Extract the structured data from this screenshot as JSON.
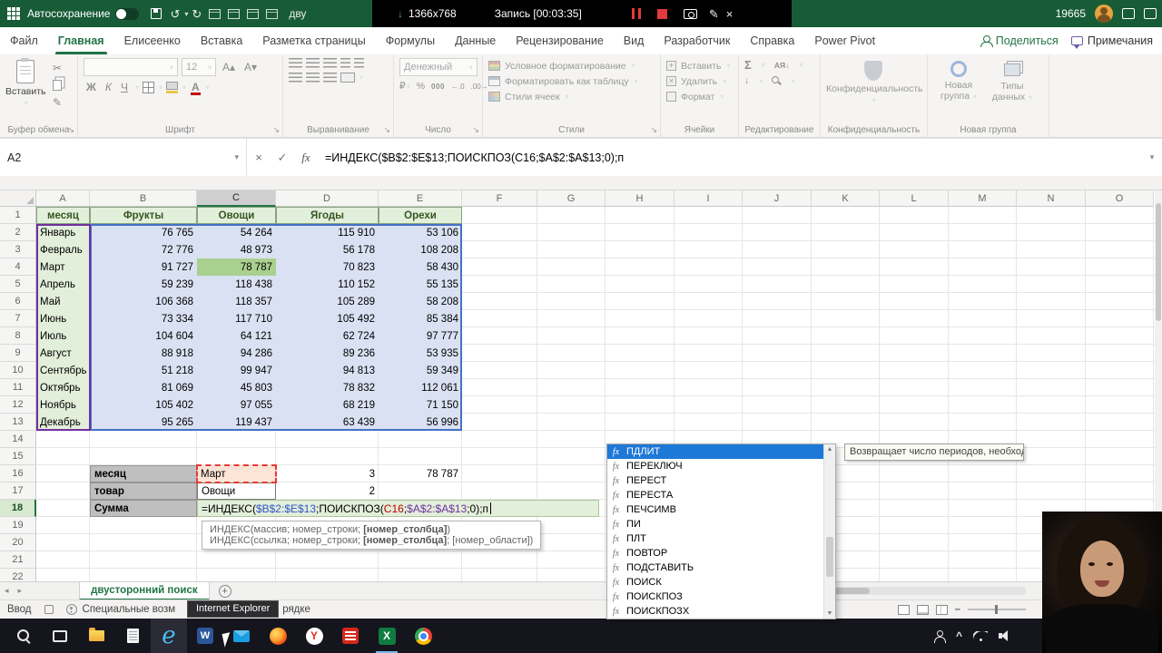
{
  "titlebar": {
    "autosave_label": "Автосохранение",
    "doc_hint": "дву",
    "recording": {
      "resolution": "1366x768",
      "label": "Запись [00:03:35]"
    },
    "counter": "19665"
  },
  "ribbon": {
    "tabs": [
      {
        "label": "Файл"
      },
      {
        "label": "Главная",
        "active": true
      },
      {
        "label": "Елисеенко"
      },
      {
        "label": "Вставка"
      },
      {
        "label": "Разметка страницы"
      },
      {
        "label": "Формулы"
      },
      {
        "label": "Данные"
      },
      {
        "label": "Рецензирование"
      },
      {
        "label": "Вид"
      },
      {
        "label": "Разработчик"
      },
      {
        "label": "Справка"
      },
      {
        "label": "Power Pivot"
      }
    ],
    "share_label": "Поделиться",
    "comments_label": "Примечания",
    "paste_label": "Вставить",
    "font_size": "12",
    "number_format": "Денежный",
    "styles_items": [
      "Условное форматирование",
      "Форматировать как таблицу",
      "Стили ячеек"
    ],
    "cells_items": [
      "Вставить",
      "Удалить",
      "Формат"
    ],
    "privacy_label": "Конфиденциальность",
    "new_group_label": "Новая группа",
    "data_types_label": "Типы данных",
    "group_labels": [
      "Буфер обмена",
      "Шрифт",
      "Выравнивание",
      "Число",
      "Стили",
      "Ячейки",
      "Редактирование",
      "Конфиденциальность",
      "Новая группа"
    ]
  },
  "formula_bar": {
    "name_box": "A2",
    "formula": "=ИНДЕКС($B$2:$E$13;ПОИСКПОЗ(C16;$A$2:$A$13;0);п"
  },
  "grid": {
    "col_letters": [
      "A",
      "B",
      "C",
      "D",
      "E",
      "F",
      "G",
      "H",
      "I",
      "J",
      "K",
      "L",
      "M",
      "N",
      "O"
    ],
    "table": {
      "headers": [
        "месяц",
        "Фрукты",
        "Овощи",
        "Ягоды",
        "Орехи"
      ],
      "rows": [
        [
          "Январь",
          "76 765",
          "54 264",
          "115 910",
          "53 106"
        ],
        [
          "Февраль",
          "72 776",
          "48 973",
          "56 178",
          "108 208"
        ],
        [
          "Март",
          "91 727",
          "78 787",
          "70 823",
          "58 430"
        ],
        [
          "Апрель",
          "59 239",
          "118 438",
          "110 152",
          "55 135"
        ],
        [
          "Май",
          "106 368",
          "118 357",
          "105 289",
          "58 208"
        ],
        [
          "Июнь",
          "73 334",
          "117 710",
          "105 492",
          "85 384"
        ],
        [
          "Июль",
          "104 604",
          "64 121",
          "62 724",
          "97 777"
        ],
        [
          "Август",
          "88 918",
          "94 286",
          "89 236",
          "53 935"
        ],
        [
          "Сентябрь",
          "51 218",
          "99 947",
          "94 813",
          "59 349"
        ],
        [
          "Октябрь",
          "81 069",
          "45 803",
          "78 832",
          "112 061"
        ],
        [
          "Ноябрь",
          "105 402",
          "97 055",
          "68 219",
          "71 150"
        ],
        [
          "Декабрь",
          "95 265",
          "119 437",
          "63 439",
          "56 996"
        ]
      ]
    },
    "lookup": {
      "row16": {
        "label": "месяц",
        "value": "Март",
        "match": "3",
        "result": "78 787"
      },
      "row17": {
        "label": "товар",
        "value": "Овощи",
        "match": "2"
      },
      "row18": {
        "label": "Сумма"
      }
    },
    "formula_parts": [
      {
        "t": "=ИНДЕКС(",
        "c": "#000000"
      },
      {
        "t": "$B$2:$E$13",
        "c": "#3355C8"
      },
      {
        "t": ";ПОИСКПОЗ(",
        "c": "#000000"
      },
      {
        "t": "C16",
        "c": "#C00000"
      },
      {
        "t": ";",
        "c": "#000000"
      },
      {
        "t": "$A$2:$A$13",
        "c": "#7030A0"
      },
      {
        "t": ";0);п ",
        "c": "#000000"
      }
    ],
    "screentip": {
      "line1_pre": "ИНДЕКС(массив; номер_строки; ",
      "line1_bold": "[номер_столбца]",
      "line1_post": ")",
      "line2_pre": "ИНДЕКС(ссылка; номер_строки; ",
      "line2_bold": "[номер_столбца]",
      "line2_post": "; [номер_области])"
    }
  },
  "autocomplete": {
    "items": [
      "ПДЛИТ",
      "ПЕРЕКЛЮЧ",
      "ПЕРЕСТ",
      "ПЕРЕСТА",
      "ПЕЧСИМВ",
      "ПИ",
      "ПЛТ",
      "ПОВТОР",
      "ПОДСТАВИТЬ",
      "ПОИСК",
      "ПОИСКПОЗ",
      "ПОИСКПОЗХ"
    ],
    "selected_index": 0,
    "tooltip": "Возвращает число периодов, необход"
  },
  "sheet_bar": {
    "active_tab": "двусторонний поиск"
  },
  "status_bar": {
    "mode": "Ввод",
    "accessibility_left": "Специальные возм",
    "accessibility_right": "рядке",
    "taskbar_tooltip": "Internet Explorer"
  },
  "taskbar": {
    "icons": [
      "search",
      "task-view",
      "file-explorer",
      "notepad",
      "internet-explorer",
      "word",
      "mail",
      "firefox",
      "yandex-browser",
      "red-app",
      "excel",
      "chrome"
    ],
    "tray": [
      "user",
      "chevron-up",
      "network",
      "volume"
    ]
  },
  "colors": {
    "excel_green": "#185C37",
    "accent_green": "#217346",
    "month_fill": "#E2EFDA",
    "data_fill": "#D9E1F2",
    "highlight_fill": "#A9D08E",
    "label_fill": "#BFBFBF",
    "lookup_value_fill": "#FCE4D6",
    "ref_blue": "#3355C8",
    "ref_red": "#C00000",
    "ref_purple": "#7030A0"
  }
}
